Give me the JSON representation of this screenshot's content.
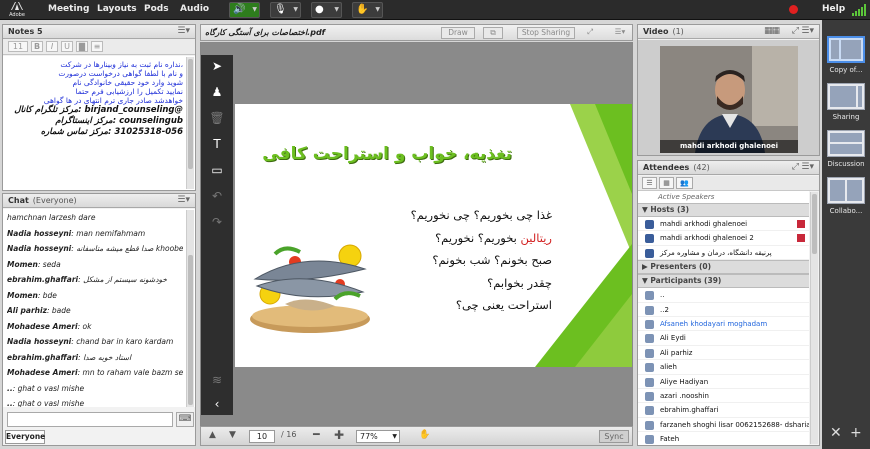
{
  "topbar": {
    "logo": "Adobe",
    "menus": [
      "Meeting",
      "Layouts",
      "Pods",
      "Audio"
    ],
    "help": "Help"
  },
  "notes": {
    "title": "Notes",
    "count": "5",
    "font_size": "11",
    "lines": [
      {
        "text": "،نداره نام ثبت به نیاز وبینارها در شرکت",
        "style": "blue"
      },
      {
        "text": "و نام با لطفا گواهی درخواست درصورت",
        "style": "blue"
      },
      {
        "text": "شوید وارد خود حقیقی خانوادگی نام",
        "style": "blue"
      },
      {
        "text": "",
        "style": "blue"
      },
      {
        "text": "نمایید تکمیل را ارزشیابی فرم حتما",
        "style": "blue"
      },
      {
        "text": "خواهدشد صادر جاری ترم انتهای در ها گواهی",
        "style": "blue"
      },
      {
        "text": "@birjand_counseling :مرکز تلگرام کانال",
        "style": "bold"
      },
      {
        "text": "counselingub :مرکز اینستاگرام",
        "style": "bold"
      },
      {
        "text": "31025318-056 :مرکز تماس شماره",
        "style": "bold"
      }
    ]
  },
  "chat": {
    "title": "Chat",
    "scope": "(Everyone)",
    "tab": "Everyone",
    "messages": [
      {
        "sender": "",
        "text": "hamchnan larzesh dare"
      },
      {
        "sender": "Nadia hosseyni",
        "text": "man nemifahmam"
      },
      {
        "sender": "Nadia hosseyni",
        "text": "صدا قطع میشه متاسفانه khoobe"
      },
      {
        "sender": "Momen",
        "text": "seda"
      },
      {
        "sender": "ebrahim.ghaffari",
        "text": "خودشونه سیستم از مشکل"
      },
      {
        "sender": "Momen",
        "text": "bde"
      },
      {
        "sender": "Ali parhiz",
        "text": "bade"
      },
      {
        "sender": "Mohadese Ameri",
        "text": "ok"
      },
      {
        "sender": "Nadia hosseyni",
        "text": "chand bar in karo kardam"
      },
      {
        "sender": "ebrahim.ghaffari",
        "text": "استاد خوبه صدا"
      },
      {
        "sender": "Mohadese Ameri",
        "text": "mn to raham vale bazm seda khobe"
      },
      {
        "sender": "..",
        "text": "ghat o vasl mishe"
      },
      {
        "sender": "..",
        "text": "ghat o vasl mishe"
      }
    ]
  },
  "share": {
    "title": "اختصاصات برای آستگی کارگاه.pdf",
    "draw": "Draw",
    "stop": "Stop Sharing",
    "page": "10",
    "total": "/ 16",
    "zoom": "77%",
    "sync": "Sync",
    "slide": {
      "title": "تغذیه، خواب و استراحت کافی",
      "lines": [
        {
          "text": "غذا چی بخوریم؟ چی نخوریم؟",
          "red": ""
        },
        {
          "text": "بخوریم؟ نخوریم؟",
          "red": "ریتالین"
        },
        {
          "text": "صبح بخونم؟ شب بخونم؟",
          "red": ""
        },
        {
          "text": "چقدر بخوابم؟",
          "red": ""
        },
        {
          "text": "استراحت یعنی چی؟",
          "red": ""
        }
      ]
    }
  },
  "video": {
    "title": "Video",
    "count": "(1)",
    "name": "mahdi arkhodi ghalenoei"
  },
  "attendees": {
    "title": "Attendees",
    "count": "(42)",
    "active": "Active Speakers",
    "hosts_label": "Hosts (3)",
    "presenters_label": "Presenters (0)",
    "participants_label": "Participants (39)",
    "hosts": [
      "mahdi arkhodi ghalenoei",
      "mahdi arkhodi ghalenoei 2",
      "پرنیقه دانشگاه، درمان و مشاوره مرکز"
    ],
    "participants": [
      "..",
      "..2",
      "Afsaneh khodayari moghadam",
      "Ali Eydi",
      "Ali parhiz",
      "alieh",
      "Aliye Hadiyan",
      "azari .nooshin",
      "ebrahim.ghaffari",
      "farzaneh shoghi lisar 0062152688- dsharia...",
      "Fateh"
    ]
  },
  "layouts": [
    {
      "label": "Copy of..."
    },
    {
      "label": "Sharing"
    },
    {
      "label": "Discussion"
    },
    {
      "label": "Collabo..."
    }
  ]
}
